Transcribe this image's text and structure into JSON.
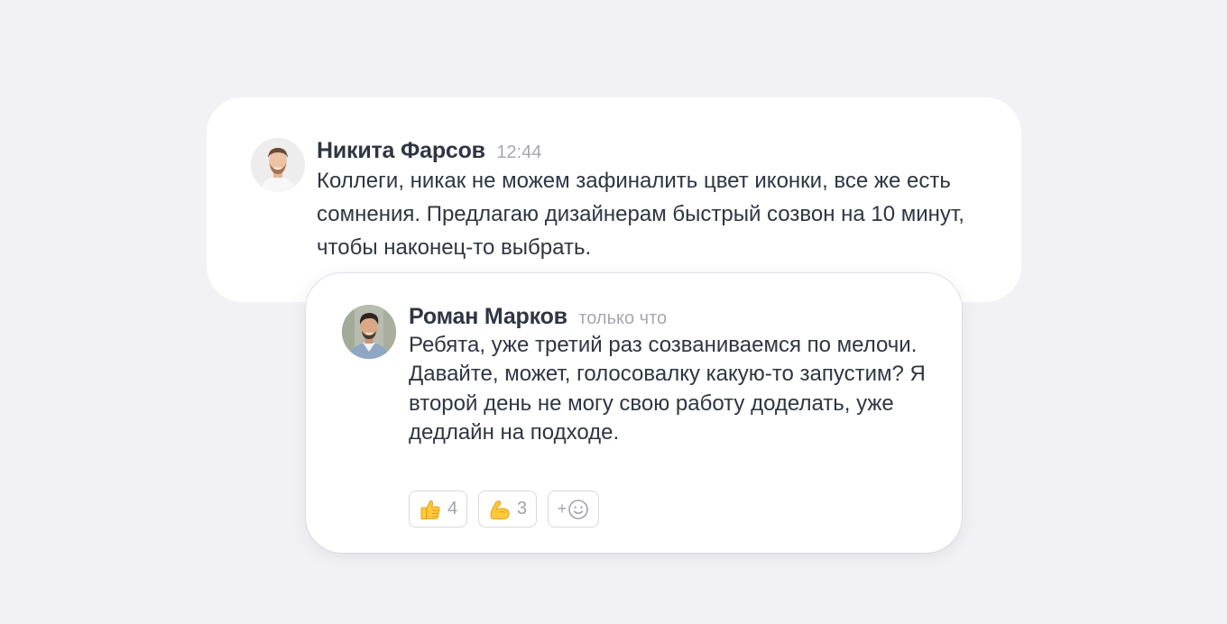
{
  "messages": [
    {
      "author": "Никита Фарсов",
      "time": "12:44",
      "avatar": "avatar-photo-icon",
      "text": "Коллеги, никак не можем зафиналить цвет иконки, все же есть сомнения. Предлагаю дизайнерам быстрый созвон на 10 минут, чтобы наконец-то выбрать."
    },
    {
      "author": "Роман Марков",
      "time": "только что",
      "avatar": "avatar-photo-icon",
      "text": "Ребята, уже третий раз созваниваемся по мелочи. Давайте, может, голосовалку какую-то запустим? Я второй день не могу свою работу доделать, уже дедлайн на подходе.",
      "reactions": [
        {
          "emoji": "thumbs-up-icon",
          "count": "4"
        },
        {
          "emoji": "flexed-biceps-icon",
          "count": "3"
        }
      ],
      "add_reaction": {
        "label": "+",
        "icon": "smiley-icon"
      }
    }
  ],
  "colors": {
    "background": "#f2f2f6",
    "card": "#ffffff",
    "text": "#2f3542",
    "muted": "#a6a8ae",
    "reaction_border": "#d7d9de"
  }
}
